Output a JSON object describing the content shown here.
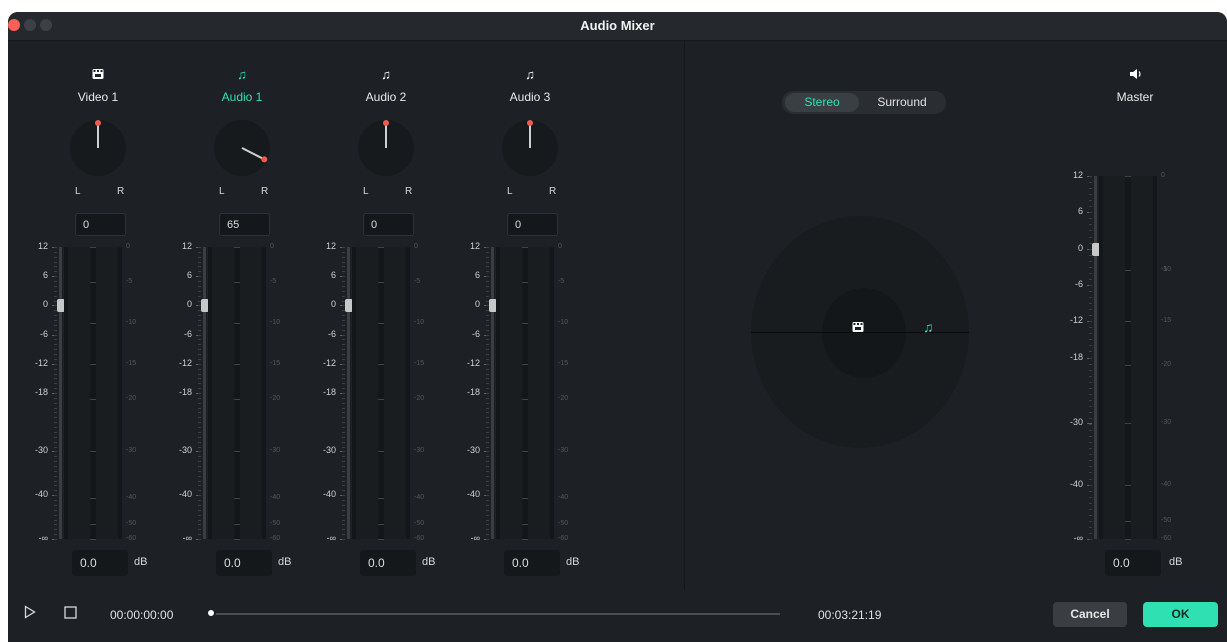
{
  "window": {
    "title": "Audio Mixer"
  },
  "channels": [
    {
      "icon": "video-clip-icon",
      "name": "Video 1",
      "active": false,
      "pan": "0",
      "volume": "0.0",
      "unit": "dB"
    },
    {
      "icon": "music-note-icon",
      "name": "Audio 1",
      "active": true,
      "pan": "65",
      "volume": "0.0",
      "unit": "dB"
    },
    {
      "icon": "music-note-icon",
      "name": "Audio 2",
      "active": false,
      "pan": "0",
      "volume": "0.0",
      "unit": "dB"
    },
    {
      "icon": "music-note-icon",
      "name": "Audio 3",
      "active": false,
      "pan": "0",
      "volume": "0.0",
      "unit": "dB"
    }
  ],
  "pan_labels": {
    "left": "L",
    "right": "R"
  },
  "fader_scale": [
    "12",
    "6",
    "0",
    "-6",
    "-12",
    "-18",
    "-30",
    "-40",
    "-∞"
  ],
  "meter_scale": [
    "0",
    "-5",
    "-10",
    "-15",
    "-20",
    "-30",
    "-40",
    "-50",
    "-60"
  ],
  "mode": {
    "stereo": "Stereo",
    "surround": "Surround",
    "selected": "Stereo"
  },
  "master": {
    "icon": "speaker-icon",
    "name": "Master",
    "volume": "0.0",
    "unit": "dB"
  },
  "playback": {
    "current_time": "00:00:00:00",
    "total_time": "00:03:21:19",
    "progress": 0
  },
  "buttons": {
    "cancel": "Cancel",
    "ok": "OK"
  },
  "colors": {
    "accent": "#2fe0b3",
    "close": "#ff5f57",
    "knob_dot": "#f05a4f"
  }
}
